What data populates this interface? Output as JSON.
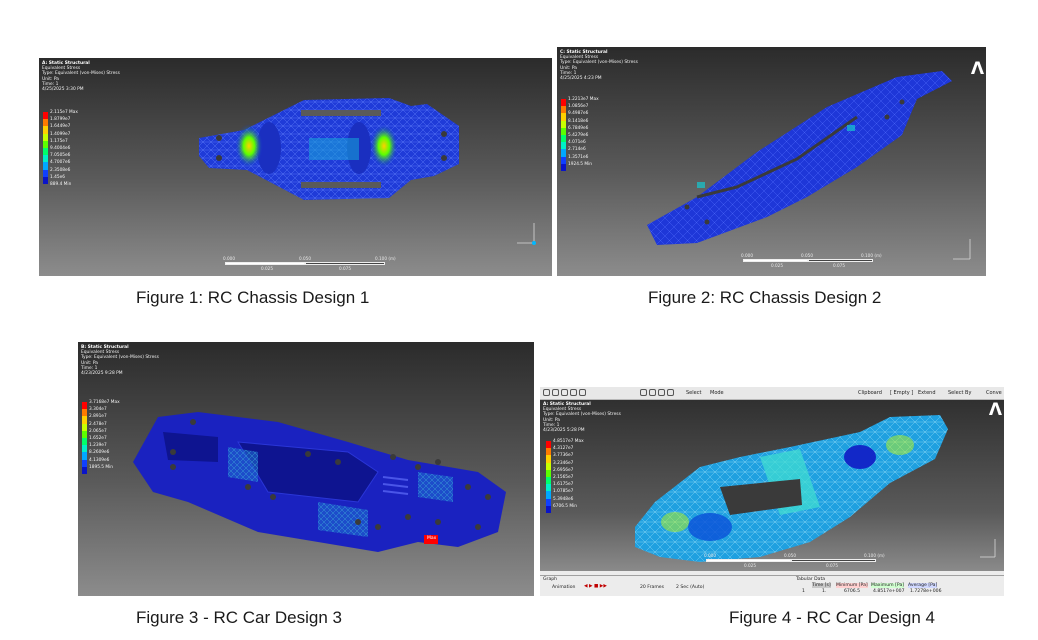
{
  "figures": [
    {
      "caption": "Figure 1: RC Chassis Design 1",
      "annotation": [
        "A: Static Structural",
        "Equivalent Stress",
        "Type: Equivalent (von-Mises) Stress",
        "Unit: Pa",
        "Time: 1",
        "4/25/2025 3:30 PM"
      ],
      "legend": {
        "max": "2.115e7 Max",
        "values": [
          "1.8799e7",
          "1.6449e7",
          "1.4099e7",
          "1.175e7",
          "9.4004e6",
          "7.0505e6",
          "4.7007e6",
          "2.3508e6"
        ],
        "min": "889.4 Min",
        "min_prefix": "1.45e6"
      },
      "scale": {
        "labels": [
          "0.000",
          "0.050",
          "0.100 (m)"
        ],
        "sub_labels": [
          "0.025",
          "0.075"
        ]
      },
      "logo": "",
      "colors": [
        "#ff0000",
        "#ff7a00",
        "#ffd000",
        "#c8ff00",
        "#5cff00",
        "#00ff6a",
        "#00f0c8",
        "#00a8ff",
        "#1040ff",
        "#0a14c8"
      ]
    },
    {
      "caption": "Figure 2: RC Chassis Design 2",
      "annotation": [
        "C: Static Structural",
        "Equivalent Stress",
        "Type: Equivalent (von-Mises) Stress",
        "Unit: Pa",
        "Time: 1",
        "4/25/2025 4:23 PM"
      ],
      "legend": {
        "max": "1.2213e7 Max",
        "values": [
          "1.0856e7",
          "9.4987e6",
          "8.1418e6",
          "6.7849e6",
          "5.4279e6",
          "4.071e6",
          "2.714e6",
          "1.3571e6"
        ],
        "min": "1924.5 Min"
      },
      "scale": {
        "labels": [
          "0.000",
          "0.050",
          "0.100 (m)"
        ],
        "sub_labels": [
          "0.025",
          "0.075"
        ]
      },
      "logo": "Λ"
    },
    {
      "caption": "Figure 3 - RC Car Design 3",
      "annotation": [
        "B: Static Structural",
        "Equivalent Stress",
        "Type: Equivalent (von-Mises) Stress",
        "Unit: Pa",
        "Time: 1",
        "4/23/2025 9:28 PM"
      ],
      "legend": {
        "max": "3.7168e7 Max",
        "values": [
          "3.304e7",
          "2.891e7",
          "2.478e7",
          "2.065e7",
          "1.652e7",
          "1.239e7",
          "8.2609e6",
          "4.1309e6"
        ],
        "min": "1895.5 Min"
      },
      "marker": "Max"
    },
    {
      "caption": "Figure 4 - RC Car Design 4",
      "annotation": [
        "A: Static Structural",
        "Equivalent Stress",
        "Type: Equivalent (von-Mises) Stress",
        "Unit: Pa",
        "Time: 1",
        "4/23/2025 5:28 PM"
      ],
      "legend": {
        "max": "4.8517e7 Max",
        "values": [
          "4.3127e7",
          "3.7736e7",
          "3.2346e7",
          "2.6956e7",
          "2.1565e7",
          "1.6175e7",
          "1.0785e7",
          "5.3948e6"
        ],
        "min": "6706.5 Min"
      },
      "scale": {
        "labels": [
          "0.000",
          "0.050",
          "0.100 (m)"
        ],
        "sub_labels": [
          "0.025",
          "0.075"
        ]
      },
      "logo": "Λ",
      "toolbar": {
        "select": "Select",
        "mode": "Mode",
        "clipboard": "Clipboard",
        "empty": "[ Empty ]",
        "extend": "Extend",
        "select_by": "Select By",
        "convert": "Conve"
      },
      "bottom": {
        "graph": "Graph",
        "animation": "Animation",
        "frames": "20 Frames",
        "speed": "2 Sec (Auto)",
        "tabular": "Tabular Data",
        "col_time": "Time [s]",
        "col_min": "Minimum [Pa]",
        "col_max": "Maximum [Pa]",
        "col_avg": "Average [Pa]",
        "row_idx": "1",
        "row_time": "1.",
        "row_min": "6706.5",
        "row_max": "4.8517e+007",
        "row_avg": "1.7278e+006"
      }
    }
  ]
}
